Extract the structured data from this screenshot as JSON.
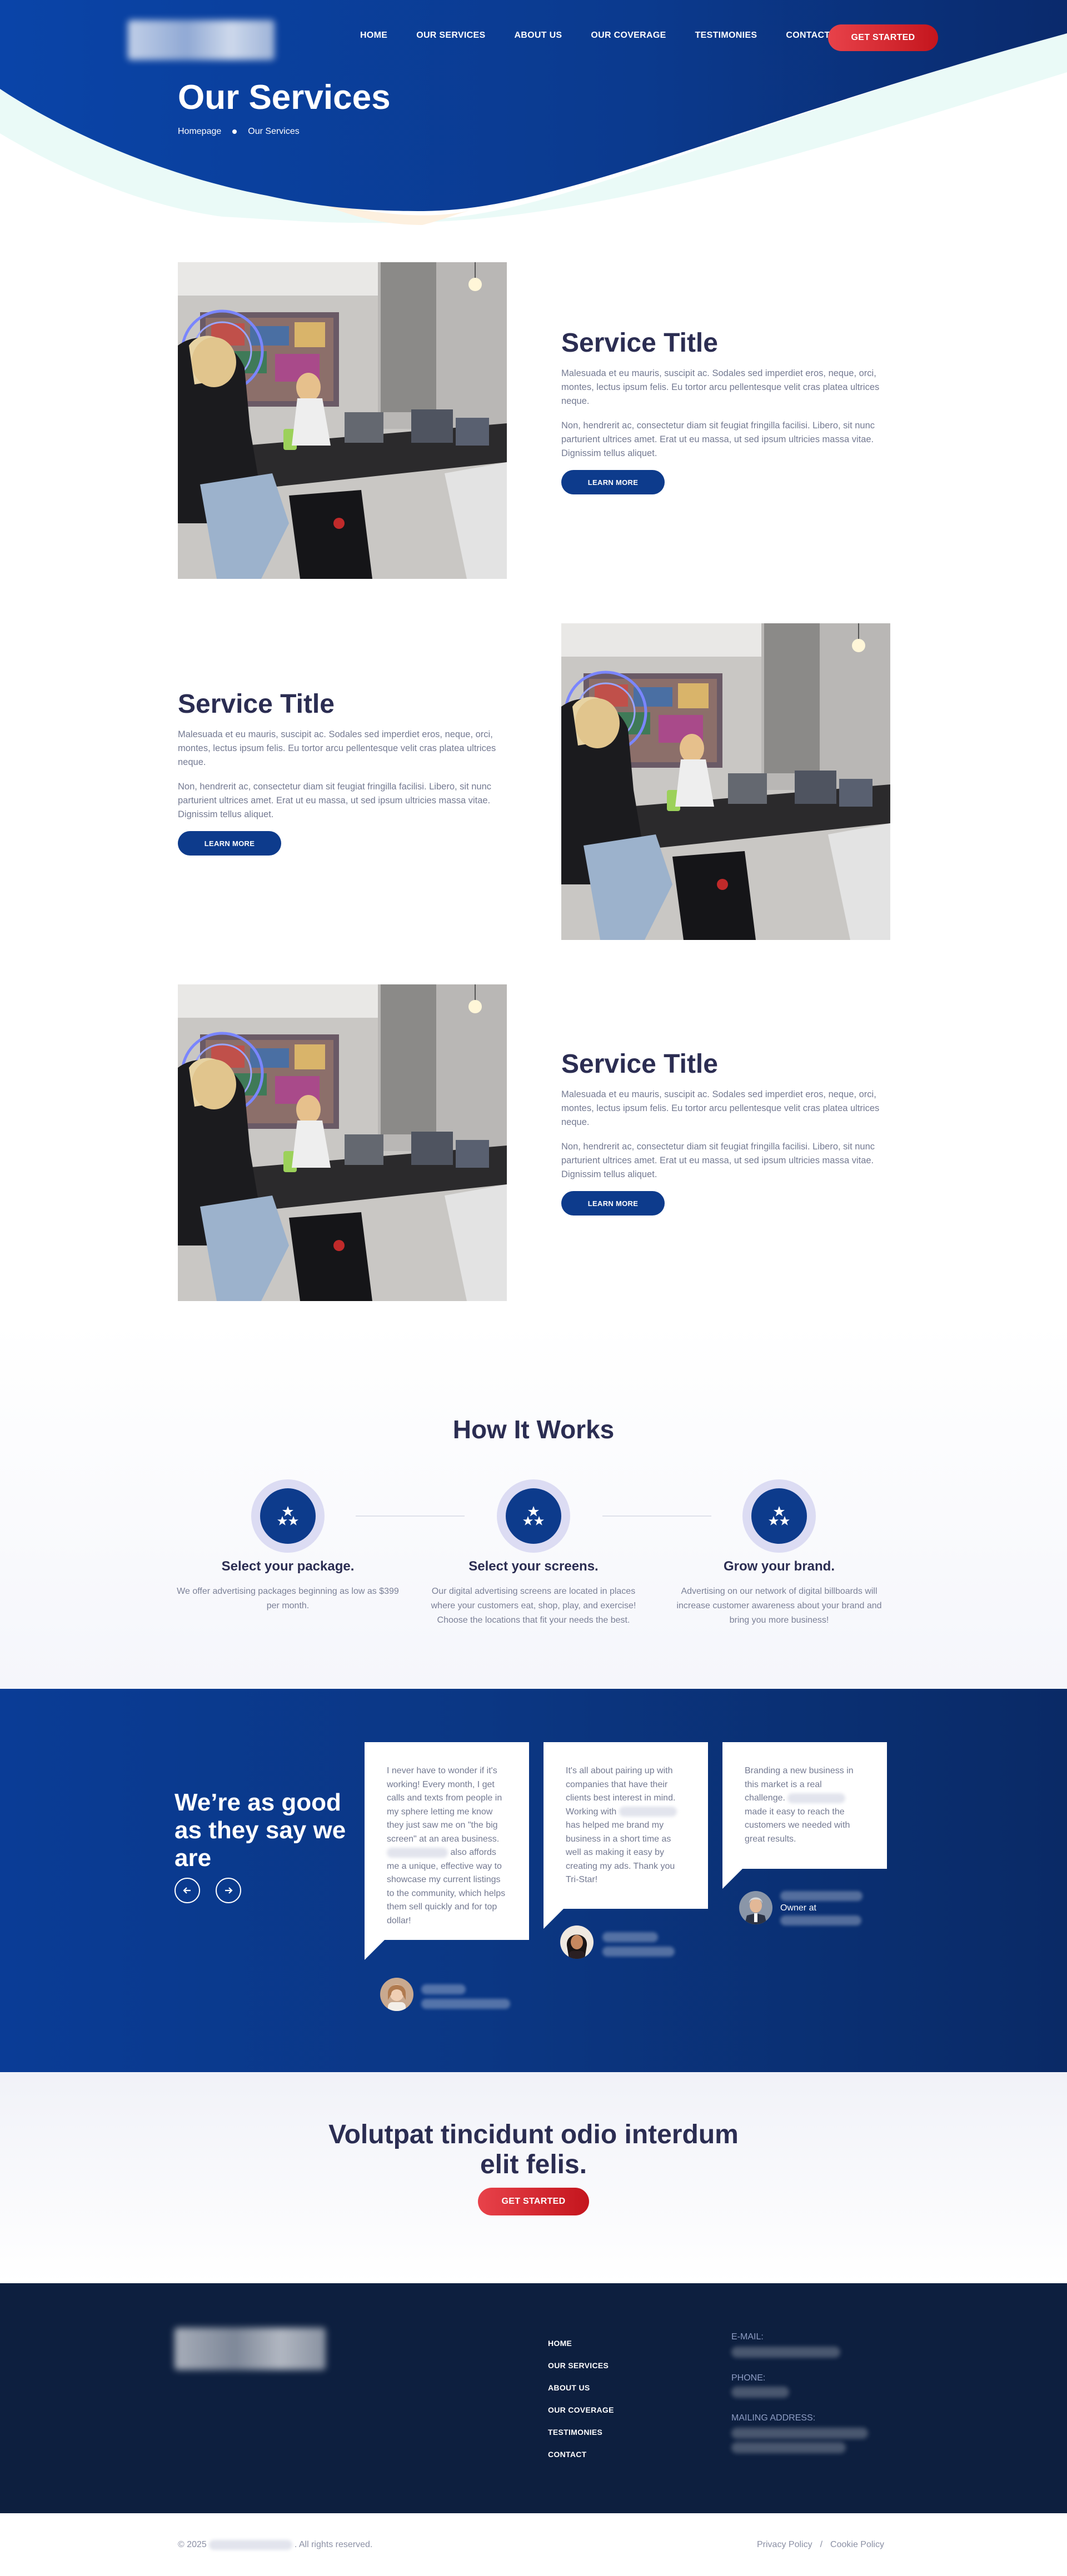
{
  "nav": {
    "items": [
      "HOME",
      "OUR SERVICES",
      "ABOUT US",
      "OUR COVERAGE",
      "TESTIMONIES",
      "CONTACT"
    ],
    "cta": "GET STARTED"
  },
  "hero": {
    "title": "Our Services",
    "breadcrumb": [
      "Homepage",
      "Our Services"
    ]
  },
  "services": [
    {
      "title": "Service Title",
      "p1": "Malesuada et eu mauris, suscipit ac. Sodales sed imperdiet eros, neque, orci, montes, lectus ipsum felis. Eu tortor arcu pellentesque velit cras platea ultrices neque.",
      "p2": "Non, hendrerit ac, consectetur diam sit feugiat fringilla facilisi. Libero, sit nunc parturient ultrices amet. Erat ut eu massa, ut sed ipsum ultricies massa vitae. Dignissim tellus aliquet.",
      "button": "LEARN MORE"
    },
    {
      "title": "Service Title",
      "p1": "Malesuada et eu mauris, suscipit ac. Sodales sed imperdiet eros, neque, orci, montes, lectus ipsum felis. Eu tortor arcu pellentesque velit cras platea ultrices neque.",
      "p2": "Non, hendrerit ac, consectetur diam sit feugiat fringilla facilisi. Libero, sit nunc parturient ultrices amet. Erat ut eu massa, ut sed ipsum ultricies massa vitae. Dignissim tellus aliquet.",
      "button": "LEARN MORE"
    },
    {
      "title": "Service Title",
      "p1": "Malesuada et eu mauris, suscipit ac. Sodales sed imperdiet eros, neque, orci, montes, lectus ipsum felis. Eu tortor arcu pellentesque velit cras platea ultrices neque.",
      "p2": "Non, hendrerit ac, consectetur diam sit feugiat fringilla facilisi. Libero, sit nunc parturient ultrices amet. Erat ut eu massa, ut sed ipsum ultricies massa vitae. Dignissim tellus aliquet.",
      "button": "LEARN MORE"
    }
  ],
  "how": {
    "title": "How It Works",
    "steps": [
      {
        "title": "Select your package.",
        "text": "We offer advertising packages beginning as low as $399 per month."
      },
      {
        "title": "Select your screens.",
        "text": "Our digital advertising screens are located in places where your customers eat, shop, play, and exercise! Choose the locations that fit your needs the best."
      },
      {
        "title": "Grow your brand.",
        "text": "Advertising on our network of digital billboards will increase customer awareness about your brand and bring you more business!"
      }
    ]
  },
  "testimonials": {
    "heading": "We’re as good as they say we are",
    "prev_icon": "arrow-left-icon",
    "next_icon": "arrow-right-icon",
    "items": [
      {
        "parts": [
          "I never have to wonder if it's working! Every month, I get calls and texts from people in my sphere letting me know they just saw me on \"the big screen\" at an area business. ",
          " also affords me a unique, effective way to showcase my current listings to the community, which helps them sell quickly and for top dollar!"
        ]
      },
      {
        "parts": [
          "It's all about pairing up with companies that have their clients best interest in mind. Working with ",
          " has helped me brand my business in a short time as well as making it easy by creating my ads. Thank you Tri-Star!"
        ]
      },
      {
        "parts": [
          "Branding a new business in this market is a real challenge. ",
          " made it easy to reach the customers we needed with great results."
        ],
        "owner_label": "Owner at"
      }
    ]
  },
  "cta": {
    "title": "Volutpat tincidunt odio interdum elit felis.",
    "button": "GET STARTED"
  },
  "footer": {
    "links": [
      "HOME",
      "OUR SERVICES",
      "ABOUT US",
      "OUR COVERAGE",
      "TESTIMONIES",
      "CONTACT"
    ],
    "email_label": "E-MAIL:",
    "phone_label": "PHONE:",
    "address_label": "MAILING ADDRESS:",
    "copyright_prefix": "© 2025",
    "copyright_suffix": ". All rights reserved.",
    "privacy": "Privacy Policy",
    "separator": "/",
    "cookie": "Cookie Policy"
  },
  "colors": {
    "navy": "#0d3b8c",
    "dark_navy": "#0d1f3f",
    "heading": "#2b2d52",
    "red": "#d9222a"
  }
}
